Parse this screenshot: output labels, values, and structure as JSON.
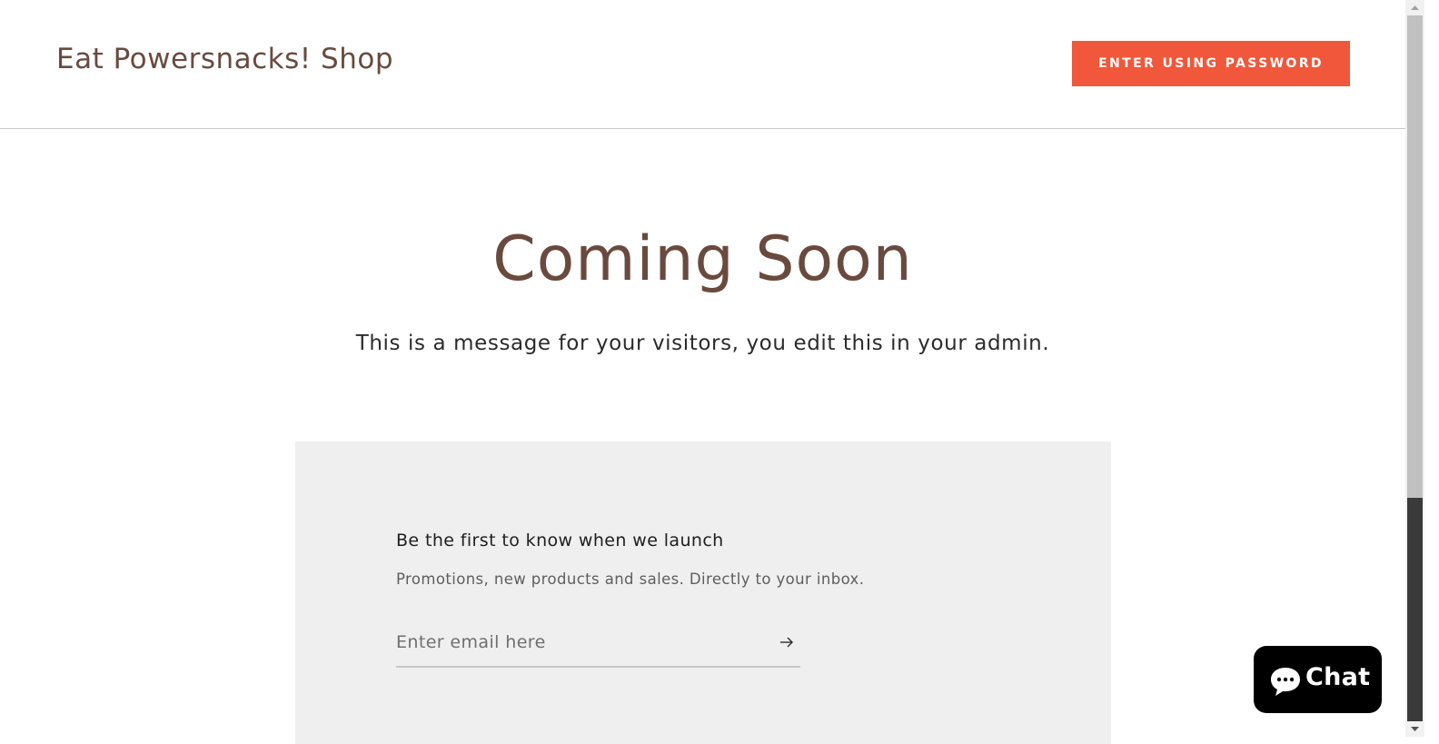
{
  "header": {
    "shop_title": "Eat Powersnacks! Shop",
    "enter_button_label": "ENTER USING PASSWORD"
  },
  "hero": {
    "title": "Coming Soon",
    "message": "This is a message for your visitors, you edit this in your admin."
  },
  "newsletter": {
    "heading": "Be the first to know when we launch",
    "subtext": "Promotions, new products and sales. Directly to your inbox.",
    "email_placeholder": "Enter email here",
    "email_value": "",
    "submit_icon": "arrow-right-icon"
  },
  "chat": {
    "label": "Chat",
    "icon": "chat-bubble-icon"
  },
  "colors": {
    "brand_text": "#6a4a3e",
    "accent_button": "#f1573a",
    "newsletter_bg": "#efefef",
    "chat_bg": "#000000"
  }
}
